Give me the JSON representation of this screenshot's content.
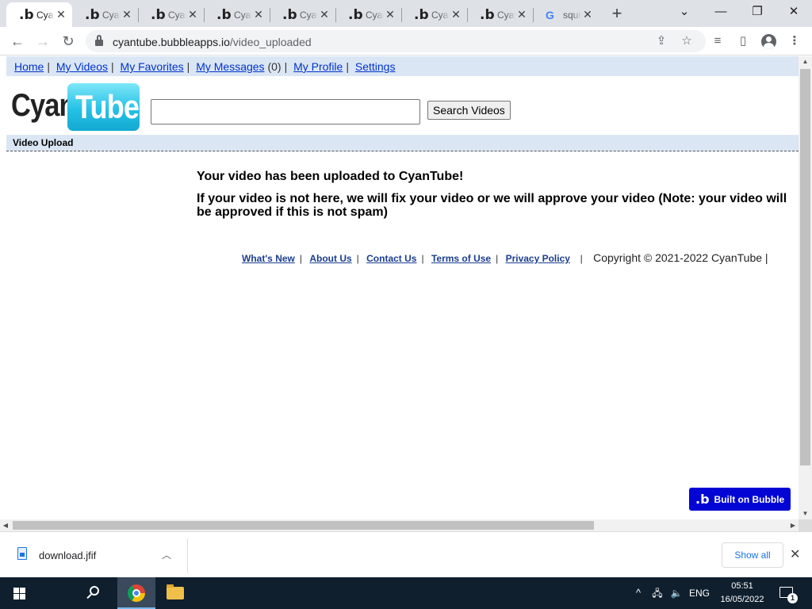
{
  "browser": {
    "tabs": [
      {
        "title": "CyanTube",
        "favicon": "bubble-b",
        "active": true
      },
      {
        "title": "CyanTube",
        "favicon": "bubble-b",
        "active": false
      },
      {
        "title": "CyanTube",
        "favicon": "bubble-b",
        "active": false
      },
      {
        "title": "CyanTube",
        "favicon": "bubble-b",
        "active": false
      },
      {
        "title": "CyanTube",
        "favicon": "bubble-b",
        "active": false
      },
      {
        "title": "CyanTube",
        "favicon": "bubble-b",
        "active": false
      },
      {
        "title": "CyanTube",
        "favicon": "bubble-b",
        "active": false
      },
      {
        "title": "CyanTube",
        "favicon": "bubble-b",
        "active": false
      },
      {
        "title": "squid g",
        "favicon": "google-g",
        "active": false
      }
    ],
    "new_tab_label": "+",
    "url_host": "cyantube.bubbleapps.io",
    "url_path": "/video_uploaded"
  },
  "site": {
    "nav": {
      "home": "Home",
      "my_videos": "My Videos",
      "my_favorites": "My Favorites",
      "my_messages": "My Messages",
      "messages_count": "(0)",
      "my_profile": "My Profile",
      "settings": "Settings"
    },
    "logo": {
      "part1": "Cyan",
      "part2": "Tube"
    },
    "search": {
      "value": "",
      "button_label": "Search Videos"
    },
    "section_title": "Video Upload",
    "message_title": "Your video has been uploaded to CyanTube!",
    "message_body": "If your video is not here, we will fix your video or we will approve your video (Note: your video will be approved if this is not spam)",
    "footer": {
      "whats_new": "What's New",
      "about_us": "About Us",
      "contact_us": "Contact Us",
      "terms": "Terms of Use",
      "privacy": "Privacy Policy",
      "copyright": "Copyright © 2021-2022 CyanTube |"
    },
    "badge_label": "Built on Bubble"
  },
  "downloads": {
    "file_name": "download.jfif",
    "show_all_label": "Show all"
  },
  "taskbar": {
    "language": "ENG",
    "time": "05:51",
    "date": "16/05/2022",
    "notification_count": "1"
  },
  "colors": {
    "nav_bg": "#dbe6f4",
    "link": "#0033cc",
    "badge_bg": "#0205d3",
    "taskbar_bg": "#101f2e"
  }
}
